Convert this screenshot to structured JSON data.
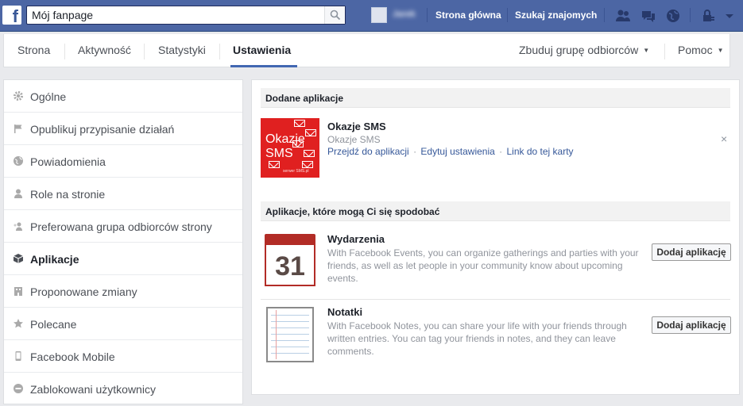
{
  "topbar": {
    "logo": "f",
    "search_value": "Mój fanpage",
    "user_name": "Jarek",
    "nav": [
      "Strona główna",
      "Szukaj znajomych"
    ],
    "bg_color": "#4c66a4",
    "icons": [
      "friends-icon",
      "messages-icon",
      "notifications-globe-icon",
      "privacy-lock-icon",
      "account-menu-icon"
    ]
  },
  "tabs": {
    "items": [
      "Strona",
      "Aktywność",
      "Statystyki",
      "Ustawienia"
    ],
    "active": "Ustawienia",
    "right": [
      "Zbuduj grupę odbiorców",
      "Pomoc"
    ]
  },
  "sidebar": {
    "items": [
      {
        "label": "Ogólne",
        "icon": "gear-icon"
      },
      {
        "label": "Opublikuj przypisanie działań",
        "icon": "flag-icon"
      },
      {
        "label": "Powiadomienia",
        "icon": "globe-icon"
      },
      {
        "label": "Role na stronie",
        "icon": "person-icon"
      },
      {
        "label": "Preferowana grupa odbiorców strony",
        "icon": "audience-icon"
      },
      {
        "label": "Aplikacje",
        "icon": "cube-icon"
      },
      {
        "label": "Proponowane zmiany",
        "icon": "building-icon"
      },
      {
        "label": "Polecane",
        "icon": "star-icon"
      },
      {
        "label": "Facebook Mobile",
        "icon": "phone-icon"
      },
      {
        "label": "Zablokowani użytkownicy",
        "icon": "blocked-icon"
      }
    ],
    "active": "Aplikacje"
  },
  "added_apps": {
    "header": "Dodane aplikacje",
    "app": {
      "thumb_line1": "Okazje",
      "thumb_line2": "SMS",
      "thumb_brand": "serwer SMS.pl",
      "title": "Okazje SMS",
      "subtitle": "Okazje SMS",
      "links": [
        "Przejdź do aplikacji",
        "Edytuj ustawienia",
        "Link do tej karty"
      ],
      "close": "×"
    }
  },
  "suggested": {
    "header": "Aplikacje, które mogą Ci się spodobać",
    "apps": [
      {
        "title": "Wydarzenia",
        "icon": "calendar-icon",
        "icon_text": "31",
        "description": "With Facebook Events, you can organize gatherings and parties with your friends, as well as let people in your community know about upcoming events.",
        "button": "Dodaj aplikację"
      },
      {
        "title": "Notatki",
        "icon": "notes-icon",
        "description": "With Facebook Notes, you can share your life with your friends through written entries. You can tag your friends in notes, and they can leave comments.",
        "button": "Dodaj aplikację"
      }
    ]
  }
}
